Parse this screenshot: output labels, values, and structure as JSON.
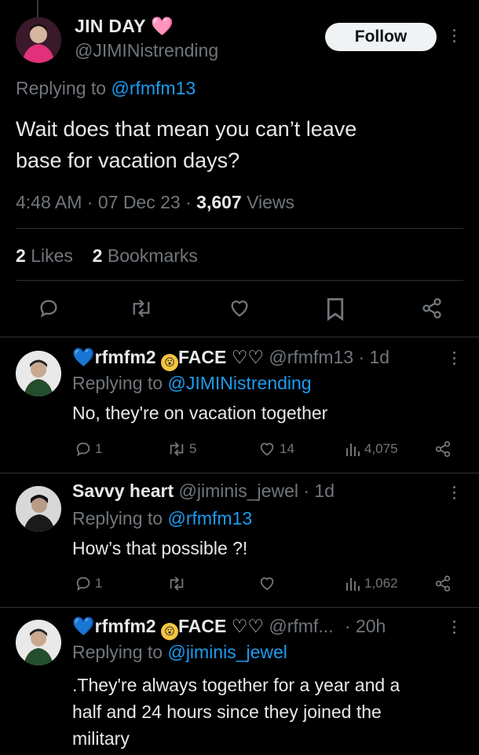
{
  "main_tweet": {
    "author_name": "JIN DAY",
    "author_emoji": "🩷",
    "author_handle": "@JIMINistrending",
    "follow_label": "Follow",
    "replying_prefix": "Replying to",
    "replying_handle": "@rfmfm13",
    "text_line1": "Wait does that mean you can’t leave",
    "text_line2": "base for vacation days?",
    "time": "4:48 AM",
    "date": "07 Dec 23",
    "views_count": "3,607",
    "views_label": "Views",
    "likes_count": "2",
    "likes_label": "Likes",
    "bookmarks_count": "2",
    "bookmarks_label": "Bookmarks"
  },
  "replies": [
    {
      "name_prefix_emoji": "💙",
      "name": "rfmfm2",
      "name_face_text": "FACE ♡♡",
      "handle": "@rfmfm13",
      "age": "· 1d",
      "replying_prefix": "Replying to",
      "replying_handle": "@JIMINistrending",
      "text": "No, they're on vacation together",
      "reply_count": "1",
      "repost_count": "5",
      "like_count": "14",
      "views": "4,075"
    },
    {
      "name": "Savvy heart",
      "handle": "@jiminis_jewel",
      "age": "· 1d",
      "replying_prefix": "Replying to",
      "replying_handle": "@rfmfm13",
      "text": "How’s that possible ?!",
      "reply_count": "1",
      "repost_count": "",
      "like_count": "",
      "views": "1,062"
    },
    {
      "name_prefix_emoji": "💙",
      "name": "rfmfm2",
      "name_face_text": "FACE ♡♡",
      "handle": "@rfmf...",
      "age": "· 20h",
      "replying_prefix": "Replying to",
      "replying_handle": "@jiminis_jewel",
      "text_line1": ".They're always together for a year and a",
      "text_line2": "half and 24 hours since they joined the",
      "text_line3": "military"
    }
  ]
}
